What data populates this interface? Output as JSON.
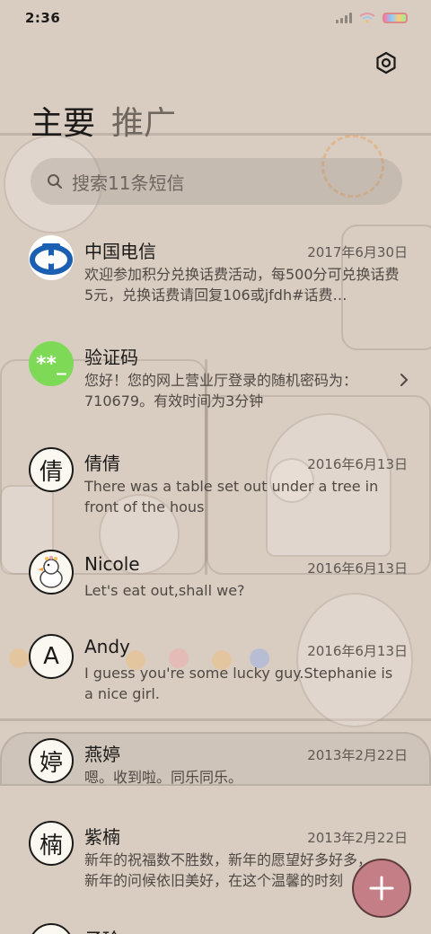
{
  "status_bar": {
    "time": "2:36"
  },
  "tabs": {
    "main_label": "主要",
    "promo_label": "推广"
  },
  "search": {
    "placeholder": "搜索11条短信"
  },
  "messages": [
    {
      "name": "中国电信",
      "date": "2017年6月30日",
      "preview": "欢迎参加积分兑换话费活动，每500分可兑换话费5元，兑换话费请回复106或jfdh#话费…",
      "avatar_icon": "china-telecom-logo-icon"
    },
    {
      "name": "验证码",
      "date": "",
      "preview": "您好！您的网上营业厅登录的随机密码为：710679。有效时间为3分钟",
      "avatar_text": "**_",
      "avatar_icon": "verification-code-icon"
    },
    {
      "name": "倩倩",
      "date": "2016年6月13日",
      "preview": "There was a table set out under a tree in front of the hous",
      "avatar_text": "倩"
    },
    {
      "name": "Nicole",
      "date": "2016年6月13日",
      "preview": "Let's eat out,shall we?",
      "avatar_icon": "goose-avatar-icon"
    },
    {
      "name": "Andy",
      "date": "2016年6月13日",
      "preview": "I guess you're some lucky guy.Stephanie is a nice girl.",
      "avatar_text": "A"
    },
    {
      "name": "燕婷",
      "date": "2013年2月22日",
      "preview": "嗯。收到啦。同乐同乐。",
      "avatar_text": "婷"
    },
    {
      "name": "紫楠",
      "date": "2013年2月22日",
      "preview": "新年的祝福数不胜数，新年的愿望好多好多，新年的问候依旧美好，在这个温馨的时刻",
      "avatar_text": "楠"
    },
    {
      "name": "子玲",
      "date": "",
      "preview": "",
      "avatar_text": ""
    }
  ],
  "colors": {
    "accent_fab": "#c47f86",
    "code_avatar": "#7ed957",
    "telecom_blue": "#1b5fb3"
  },
  "icons": {
    "settings": "gear-icon",
    "search": "search-icon",
    "compose": "plus-icon",
    "chevron": "chevron-right-icon"
  }
}
